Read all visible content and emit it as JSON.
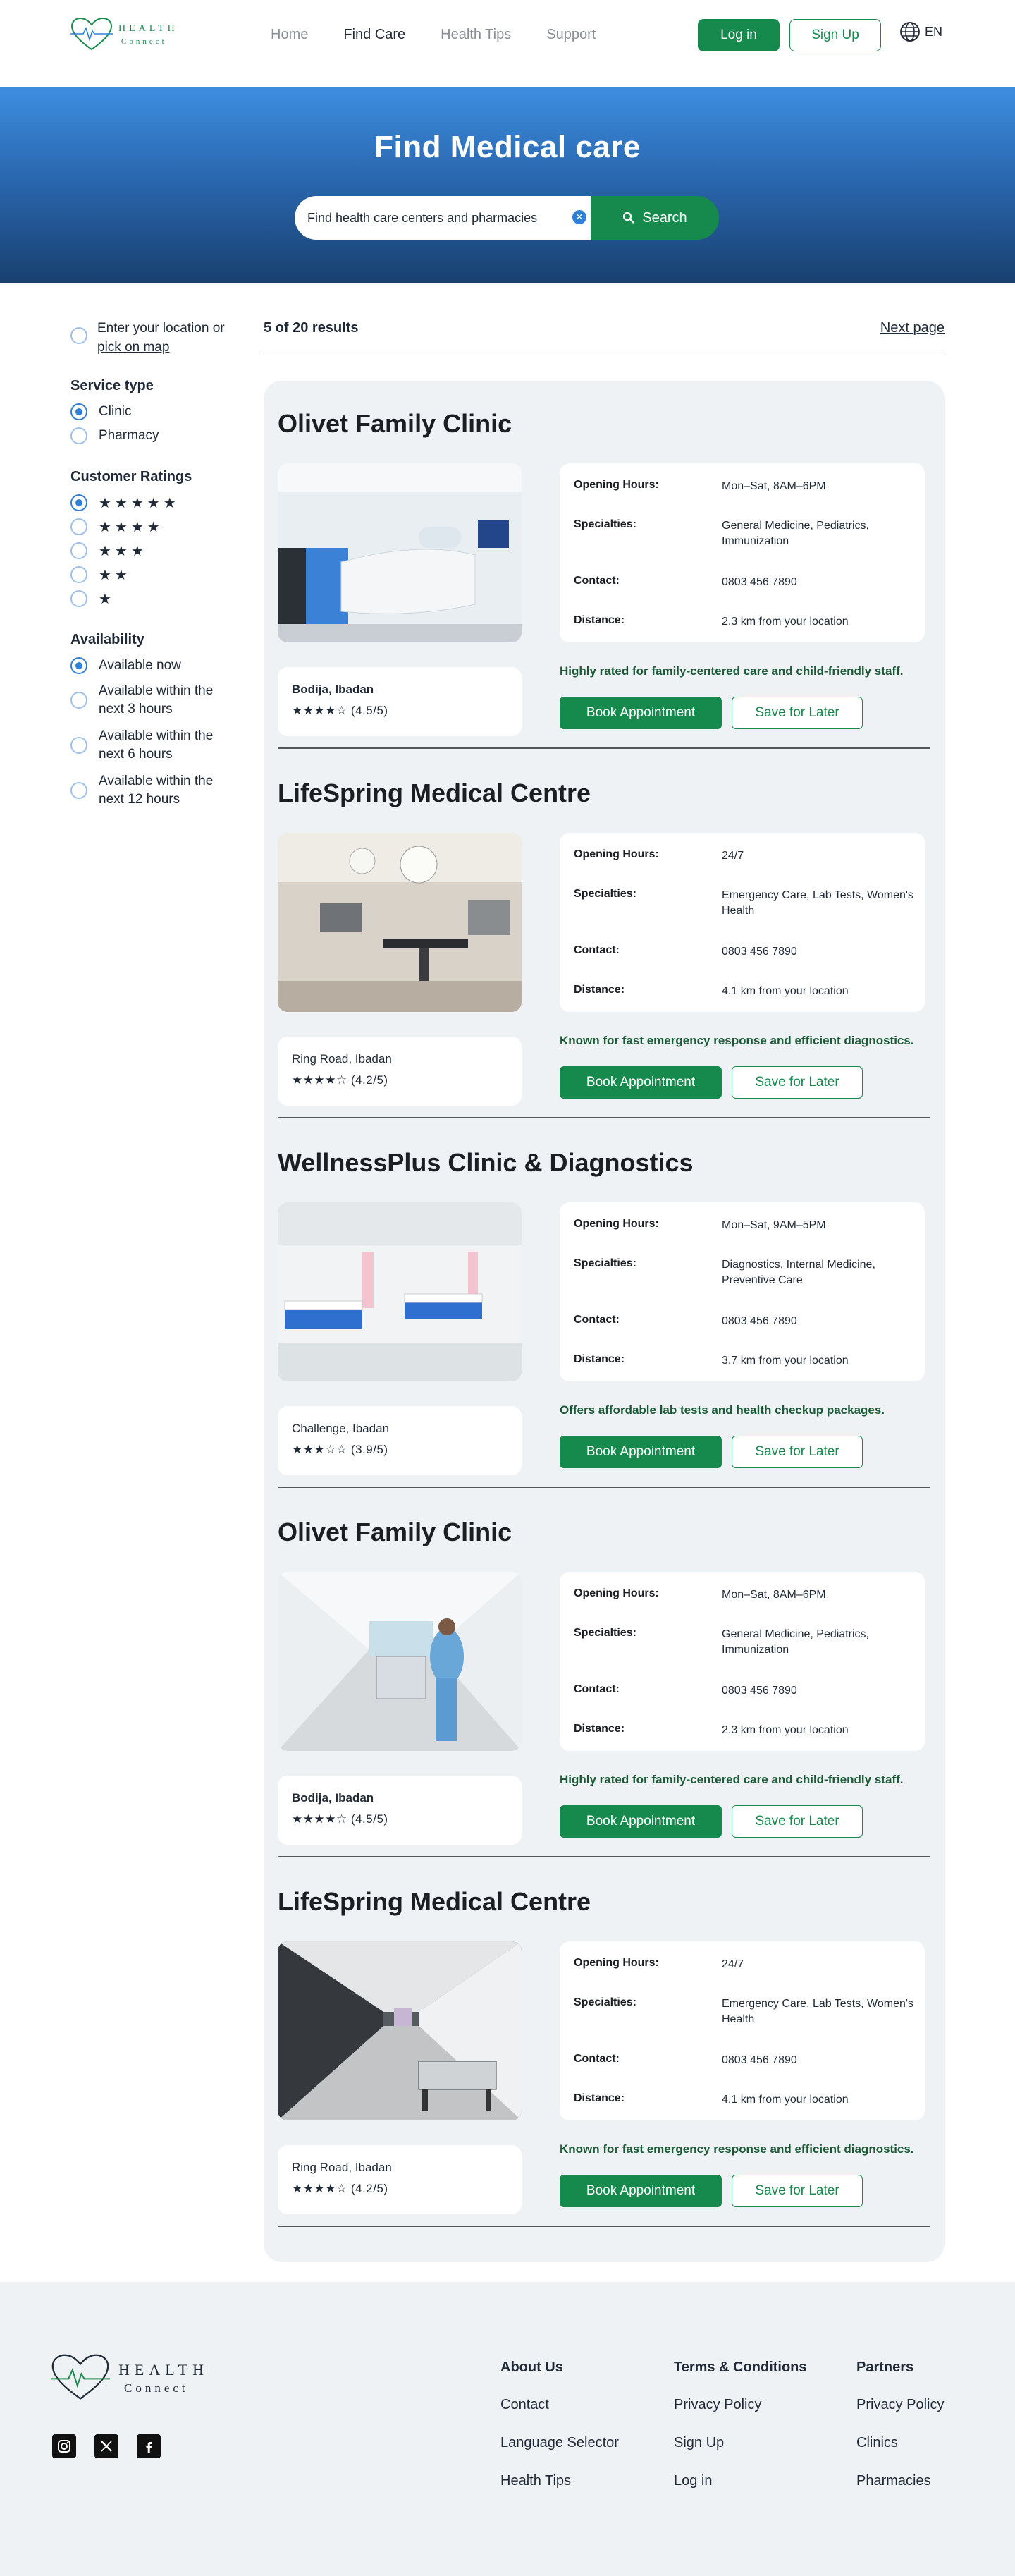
{
  "brand": {
    "line1": "HEALTH",
    "line2": "Connect"
  },
  "nav": {
    "links": [
      {
        "label": "Home"
      },
      {
        "label": "Find Care"
      },
      {
        "label": "Health Tips"
      },
      {
        "label": "Support"
      }
    ],
    "active": "Find Care",
    "login": "Log in",
    "signup": "Sign Up",
    "language": "EN"
  },
  "hero": {
    "title": "Find Medical care",
    "search_value": "Find health care centers and pharmacies",
    "search_button": "Search"
  },
  "filters": {
    "location_prefix": "Enter your location or ",
    "location_link": "pick on map",
    "service_type": {
      "title": "Service type",
      "options": [
        {
          "label": "Clinic",
          "selected": true
        },
        {
          "label": "Pharmacy",
          "selected": false
        }
      ]
    },
    "ratings": {
      "title": "Customer Ratings",
      "options": [
        {
          "stars": "★★★★★",
          "selected": true
        },
        {
          "stars": "★★★★",
          "selected": false
        },
        {
          "stars": "★★★",
          "selected": false
        },
        {
          "stars": "★★",
          "selected": false
        },
        {
          "stars": "★",
          "selected": false
        }
      ]
    },
    "availability": {
      "title": "Availability",
      "options": [
        {
          "label": "Available now",
          "selected": true
        },
        {
          "label": "Available within the next 3 hours",
          "selected": false
        },
        {
          "label": "Available within the next 6 hours",
          "selected": false
        },
        {
          "label": "Available within the next 12 hours",
          "selected": false
        }
      ]
    }
  },
  "results": {
    "count_text": "5 of 20 results",
    "next_page": "Next page",
    "labels": {
      "opening_hours": "Opening Hours:",
      "specialties": "Specialties:",
      "contact": "Contact:",
      "distance": "Distance:"
    },
    "items": [
      {
        "name": "Olivet Family Clinic",
        "photo": "reception",
        "location": "Bodija, Ibadan",
        "location_bold": true,
        "rating": "★★★★☆ (4.5/5)",
        "hours": "Mon–Sat, 8AM–6PM",
        "specialties": "General Medicine, Pediatrics, Immunization",
        "contact": "0803 456 7890",
        "distance": "2.3 km from your location",
        "blurb": "Highly rated for family-centered care and child-friendly staff.",
        "book": "Book Appointment",
        "save": "Save for Later"
      },
      {
        "name": "LifeSpring Medical Centre",
        "photo": "operating-room",
        "location": "Ring Road, Ibadan",
        "location_bold": false,
        "rating": "★★★★☆ (4.2/5)",
        "hours": "24/7",
        "specialties": "Emergency Care, Lab Tests, Women's Health",
        "contact": "0803 456 7890",
        "distance": "4.1 km from your location",
        "blurb": "Known for fast emergency response and efficient diagnostics.",
        "book": "Book Appointment",
        "save": "Save for Later"
      },
      {
        "name": "WellnessPlus Clinic & Diagnostics",
        "photo": "ward",
        "location": "Challenge, Ibadan",
        "location_bold": false,
        "rating": "★★★☆☆ (3.9/5)",
        "hours": "Mon–Sat, 9AM–5PM",
        "specialties": "Diagnostics, Internal Medicine, Preventive Care",
        "contact": "0803 456 7890",
        "distance": "3.7 km from your location",
        "blurb": "Offers affordable lab tests and health checkup packages.",
        "book": "Book Appointment",
        "save": "Save for Later"
      },
      {
        "name": "Olivet Family Clinic",
        "photo": "corridor-staff",
        "location": "Bodija, Ibadan",
        "location_bold": true,
        "rating": "★★★★☆ (4.5/5)",
        "hours": "Mon–Sat, 8AM–6PM",
        "specialties": "General Medicine, Pediatrics, Immunization",
        "contact": "0803 456 7890",
        "distance": "2.3 km from your location",
        "blurb": "Highly rated for family-centered care and child-friendly staff.",
        "book": "Book Appointment",
        "save": "Save for Later"
      },
      {
        "name": "LifeSpring Medical Centre",
        "photo": "corridor-dark",
        "location": "Ring Road, Ibadan",
        "location_bold": false,
        "rating": "★★★★☆ (4.2/5)",
        "hours": "24/7",
        "specialties": "Emergency Care, Lab Tests, Women's Health",
        "contact": "0803 456 7890",
        "distance": "4.1 km from your location",
        "blurb": "Known for fast emergency response and efficient diagnostics.",
        "book": "Book Appointment",
        "save": "Save for Later"
      }
    ]
  },
  "footer": {
    "columns": [
      {
        "title": "About Us",
        "links": [
          "Contact",
          "Language Selector",
          "Health Tips"
        ]
      },
      {
        "title": "Terms & Conditions",
        "links": [
          "Privacy Policy",
          "Sign Up",
          "Log in"
        ]
      },
      {
        "title": "Partners",
        "links": [
          "Privacy Policy",
          "Clinics",
          "Pharmacies"
        ]
      }
    ],
    "socials": [
      "instagram-icon",
      "x-icon",
      "facebook-icon"
    ]
  },
  "colors": {
    "primary_green": "#158a4c",
    "hero_blue": "#2a68b0",
    "panel_bg": "#eef2f5"
  }
}
